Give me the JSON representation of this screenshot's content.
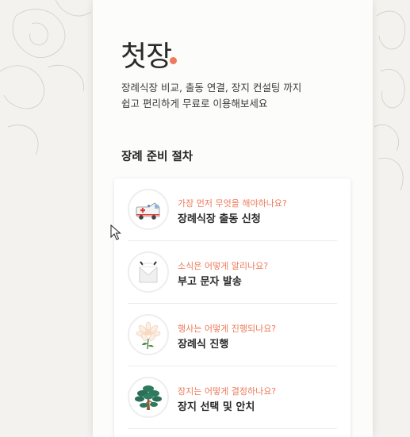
{
  "brand": {
    "name": "첫장",
    "dot_color": "#ee7a5a"
  },
  "tagline": {
    "line1": "장례식장 비교, 출동 연결, 장지 컨설팅 까지",
    "line2": "쉽고 편리하게 무료로 이용해보세요"
  },
  "section": {
    "title": "장례 준비 절차"
  },
  "steps": [
    {
      "question": "가장 먼저 무엇을 해야하나요?",
      "title": "장례식장 출동 신청",
      "icon": "ambulance-icon"
    },
    {
      "question": "소식은 어떻게 알리나요?",
      "title": "부고 문자 발송",
      "icon": "envelope-icon"
    },
    {
      "question": "행사는 어떻게 진행되나요?",
      "title": "장례식 진행",
      "icon": "chrysanthemum-icon"
    },
    {
      "question": "장지는 어떻게 결정하나요?",
      "title": "장지 선택 및 안치",
      "icon": "pine-tree-icon"
    }
  ],
  "colors": {
    "accent": "#ee7a5a",
    "background": "#f3f2ee",
    "panel": "#fcfcfa"
  }
}
